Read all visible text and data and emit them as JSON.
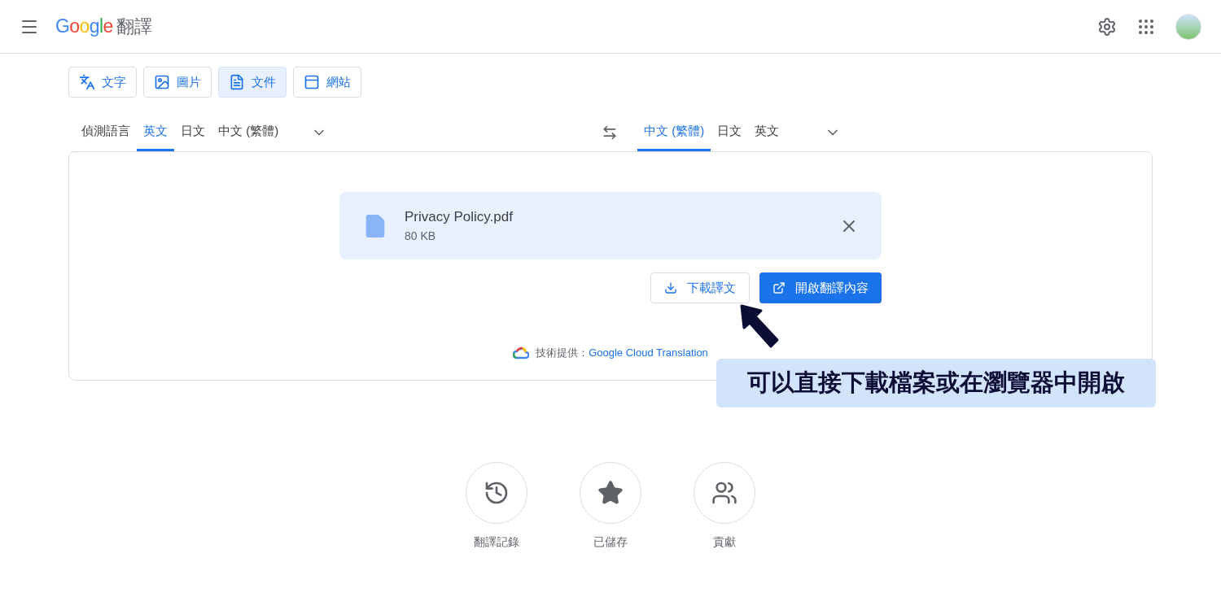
{
  "header": {
    "logo": "Google",
    "title": "翻譯"
  },
  "modes": [
    {
      "kind": "text",
      "label": "文字",
      "selected": false
    },
    {
      "kind": "image",
      "label": "圖片",
      "selected": false
    },
    {
      "kind": "document",
      "label": "文件",
      "selected": true
    },
    {
      "kind": "website",
      "label": "網站",
      "selected": false
    }
  ],
  "source_languages": [
    {
      "label": "偵測語言",
      "selected": false
    },
    {
      "label": "英文",
      "selected": true
    },
    {
      "label": "日文",
      "selected": false
    },
    {
      "label": "中文 (繁體)",
      "selected": false
    }
  ],
  "target_languages": [
    {
      "label": "中文 (繁體)",
      "selected": true
    },
    {
      "label": "日文",
      "selected": false
    },
    {
      "label": "英文",
      "selected": false
    }
  ],
  "file": {
    "name": "Privacy Policy.pdf",
    "size": "80 KB"
  },
  "actions": [
    {
      "kind": "outline",
      "label": "下載譯文"
    },
    {
      "kind": "primary",
      "label": "開啟翻譯內容"
    }
  ],
  "credit": {
    "prefix": "技術提供：",
    "link": "Google Cloud Translation"
  },
  "shortcuts": [
    {
      "kind": "history",
      "label": "翻譯記錄"
    },
    {
      "kind": "saved",
      "label": "已儲存"
    },
    {
      "kind": "contribute",
      "label": "貢獻"
    }
  ],
  "callout": "可以直接下載檔案或在瀏覽器中開啟"
}
